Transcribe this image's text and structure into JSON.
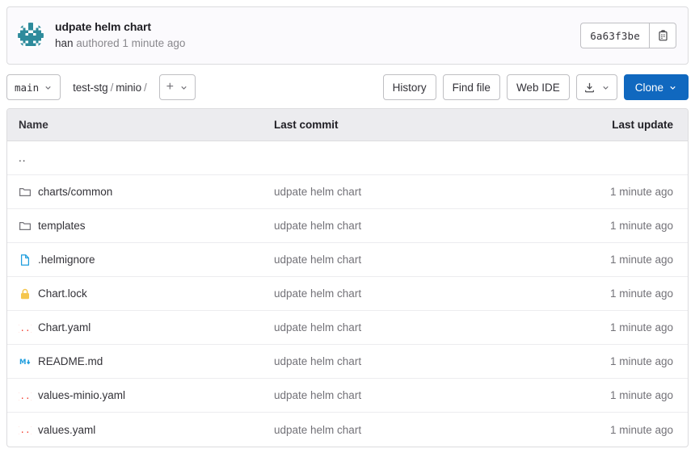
{
  "commit_header": {
    "avatar_name": "user-avatar-identicon",
    "avatar_color": "#2e8b9c",
    "title": "udpate helm chart",
    "author": "han",
    "meta": "authored 1 minute ago",
    "sha": "6a63f3be",
    "copy_icon": "clipboard-copy-icon"
  },
  "toolbar": {
    "branch": "main",
    "branch_chevron": "chevron-down-icon",
    "breadcrumb": [
      {
        "label": "test-stg",
        "sep": "/"
      },
      {
        "label": "minio",
        "sep": "/"
      }
    ],
    "add_label": "+",
    "add_chevron": "chevron-down-icon",
    "history_label": "History",
    "find_file_label": "Find file",
    "web_ide_label": "Web IDE",
    "download_icon": "download-icon",
    "download_chevron": "chevron-down-icon",
    "clone_label": "Clone",
    "clone_chevron": "chevron-down-icon",
    "clone_color": "#1068bf"
  },
  "tree": {
    "columns": {
      "name": "Name",
      "last_commit": "Last commit",
      "last_update": "Last update"
    },
    "parent_row": {
      "label": ".."
    },
    "rows": [
      {
        "name": "charts/common",
        "icon": "folder-icon",
        "icon_color": "#737278",
        "commit": "udpate helm chart",
        "update": "1 minute ago"
      },
      {
        "name": "templates",
        "icon": "folder-icon",
        "icon_color": "#737278",
        "commit": "udpate helm chart",
        "update": "1 minute ago"
      },
      {
        "name": ".helmignore",
        "icon": "document-icon",
        "icon_color": "#1f9ede",
        "commit": "udpate helm chart",
        "update": "1 minute ago"
      },
      {
        "name": "Chart.lock",
        "icon": "lock-icon",
        "icon_color": "#f5c64e",
        "commit": "udpate helm chart",
        "update": "1 minute ago"
      },
      {
        "name": "Chart.yaml",
        "icon": "yaml-braces-icon",
        "icon_color": "#f44336",
        "commit": "udpate helm chart",
        "update": "1 minute ago"
      },
      {
        "name": "README.md",
        "icon": "markdown-icon",
        "icon_color": "#1f9ede",
        "commit": "udpate helm chart",
        "update": "1 minute ago"
      },
      {
        "name": "values-minio.yaml",
        "icon": "yaml-braces-icon",
        "icon_color": "#f44336",
        "commit": "udpate helm chart",
        "update": "1 minute ago"
      },
      {
        "name": "values.yaml",
        "icon": "yaml-braces-icon",
        "icon_color": "#f44336",
        "commit": "udpate helm chart",
        "update": "1 minute ago"
      }
    ]
  }
}
